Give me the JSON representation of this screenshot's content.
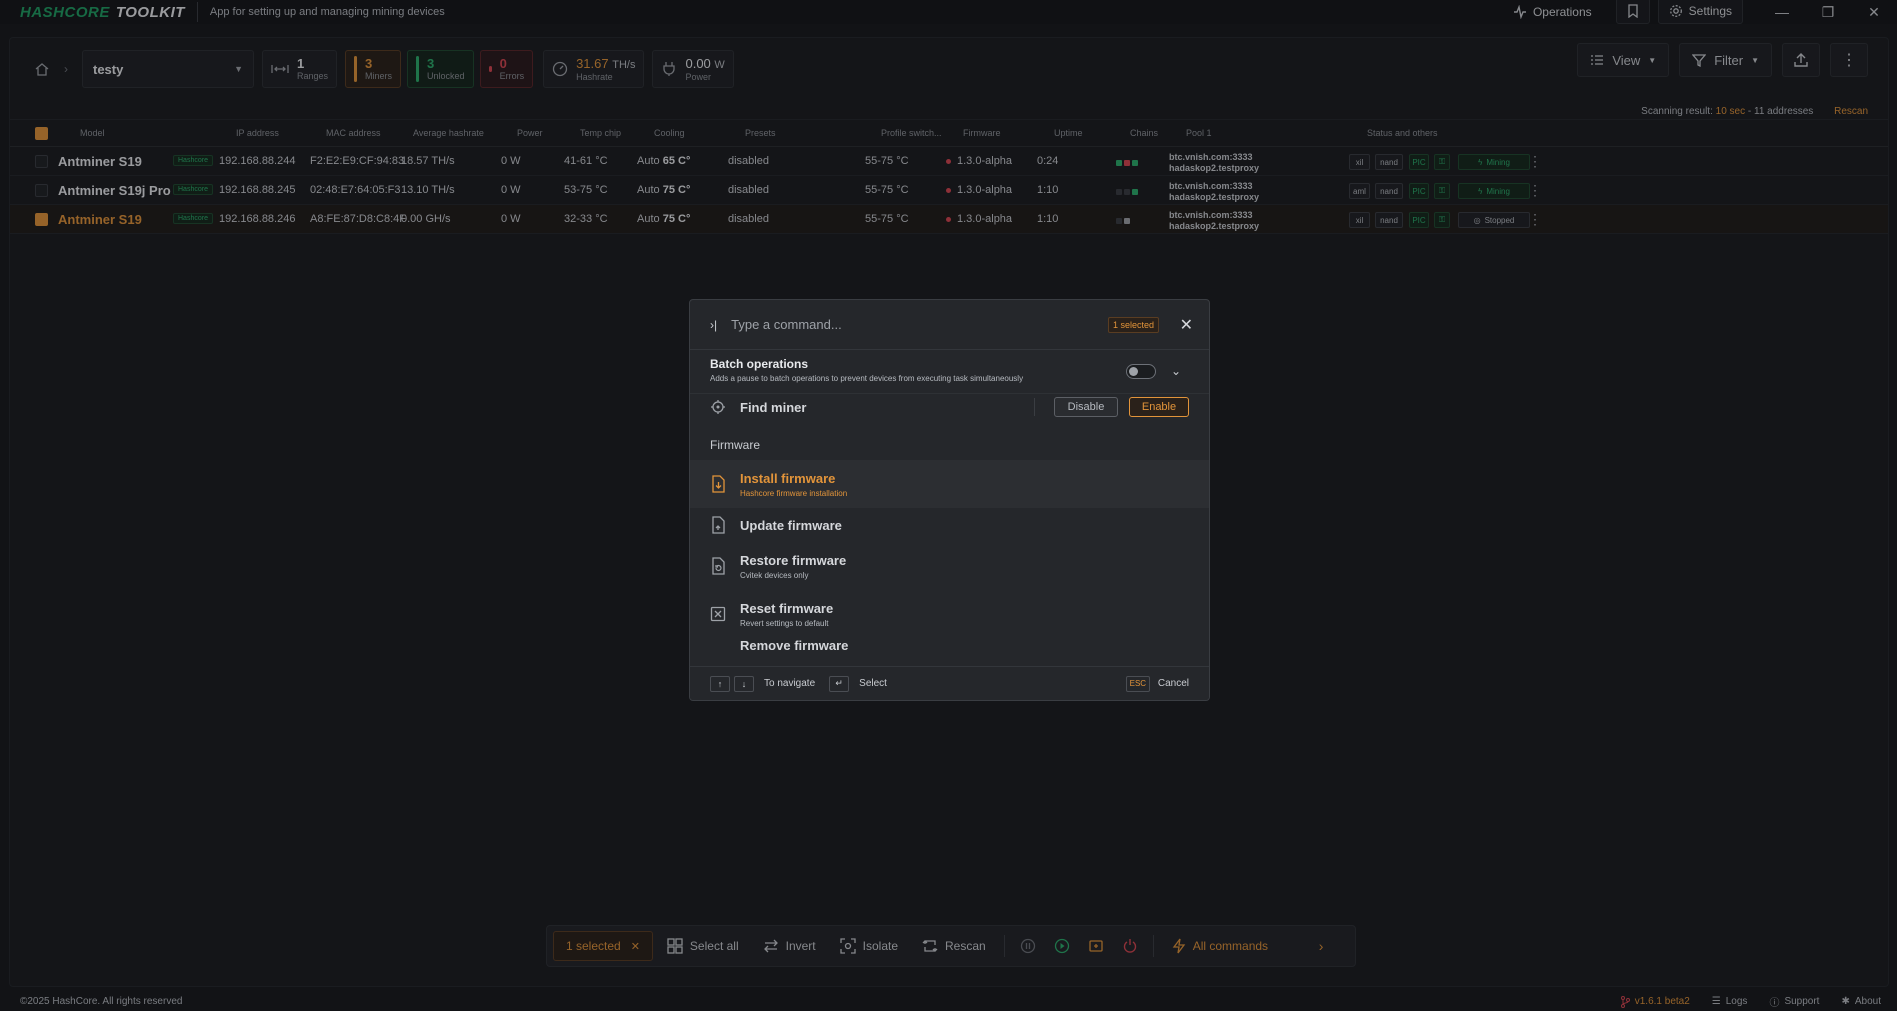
{
  "app": {
    "logo_left": "HASHCORE",
    "logo_right": "TOOLKIT",
    "subtitle": "App for setting up and managing mining devices",
    "operations_label": "Operations",
    "settings_label": "Settings"
  },
  "toolbar": {
    "group_name": "testy",
    "ranges": {
      "value": "1",
      "label": "Ranges"
    },
    "miners": {
      "value": "3",
      "label": "Miners"
    },
    "unlocked": {
      "value": "3",
      "label": "Unlocked"
    },
    "errors": {
      "value": "0",
      "label": "Errors"
    },
    "hashrate": {
      "value": "31.67",
      "unit": "TH/s",
      "label": "Hashrate"
    },
    "power": {
      "value": "0.00",
      "unit": "W",
      "label": "Power"
    },
    "view_label": "View",
    "filter_label": "Filter"
  },
  "scan": {
    "prefix": "Scanning result:",
    "highlight": "10 sec",
    "suffix": "- 11 addresses",
    "rescan": "Rescan"
  },
  "table": {
    "headers": [
      "Model",
      "IP address",
      "MAC address",
      "Average hashrate",
      "Power",
      "Temp chip",
      "Cooling",
      "Presets",
      "Profile switch...",
      "Firmware",
      "Uptime",
      "Chains",
      "Pool 1",
      "Status and others"
    ],
    "rows": [
      {
        "model": "Antminer S19",
        "tag": "Hashcore",
        "ip": "192.168.88.244",
        "mac": "F2:E2:E9:CF:94:83",
        "hashrate": "18.57 TH/s",
        "power": "0 W",
        "temp": "41-61 °C",
        "cooling_mode": "Auto",
        "cooling_val": "65 C°",
        "presets": "disabled",
        "profile": "55-75 °C",
        "firmware": "1.3.0-alpha",
        "uptime": "0:24",
        "pool_a": "btc.vnish.com:3333",
        "pool_b": "hadaskop2.testproxy",
        "p1": "xil",
        "p2": "nand",
        "p3": "PIC",
        "status": "Mining",
        "selected": false
      },
      {
        "model": "Antminer S19j Pro",
        "tag": "Hashcore",
        "ip": "192.168.88.245",
        "mac": "02:48:E7:64:05:F3",
        "hashrate": "13.10 TH/s",
        "power": "0 W",
        "temp": "53-75 °C",
        "cooling_mode": "Auto",
        "cooling_val": "75 C°",
        "presets": "disabled",
        "profile": "55-75 °C",
        "firmware": "1.3.0-alpha",
        "uptime": "1:10",
        "pool_a": "btc.vnish.com:3333",
        "pool_b": "hadaskop2.testproxy",
        "p1": "aml",
        "p2": "nand",
        "p3": "PIC",
        "status": "Mining",
        "selected": false
      },
      {
        "model": "Antminer S19",
        "tag": "Hashcore",
        "ip": "192.168.88.246",
        "mac": "A8:FE:87:D8:C8:4F",
        "hashrate": "0.00 GH/s",
        "power": "0 W",
        "temp": "32-33 °C",
        "cooling_mode": "Auto",
        "cooling_val": "75 C°",
        "presets": "disabled",
        "profile": "55-75 °C",
        "firmware": "1.3.0-alpha",
        "uptime": "1:10",
        "pool_a": "btc.vnish.com:3333",
        "pool_b": "hadaskop2.testproxy",
        "p1": "xil",
        "p2": "nand",
        "p3": "PIC",
        "status": "Stopped",
        "selected": true
      }
    ]
  },
  "palette": {
    "placeholder": "Type a command...",
    "selected_badge": "1 selected",
    "batch_title": "Batch operations",
    "batch_desc": "Adds a pause to batch operations to prevent devices from executing task simultaneously",
    "find_miner": "Find miner",
    "disable": "Disable",
    "enable": "Enable",
    "section": "Firmware",
    "items": [
      {
        "title": "Install firmware",
        "desc": "Hashcore firmware installation"
      },
      {
        "title": "Update firmware",
        "desc": ""
      },
      {
        "title": "Restore firmware",
        "desc": "Cvitek devices only"
      },
      {
        "title": "Reset firmware",
        "desc": "Revert settings to default"
      },
      {
        "title": "Remove firmware",
        "desc": ""
      }
    ],
    "nav_hint": "To navigate",
    "select_hint": "Select",
    "esc_key": "ESC",
    "cancel": "Cancel"
  },
  "actionbar": {
    "selected": "1 selected",
    "select_all": "Select all",
    "invert": "Invert",
    "isolate": "Isolate",
    "rescan": "Rescan",
    "all_commands": "All commands"
  },
  "footer": {
    "copyright": "©2025 HashCore. All rights reserved",
    "version": "v1.6.1 beta2",
    "logs": "Logs",
    "support": "Support",
    "about": "About"
  },
  "colors": {
    "accent": "#e2943a",
    "success": "#2cae6c",
    "danger": "#d64550",
    "bg": "#17191c"
  }
}
